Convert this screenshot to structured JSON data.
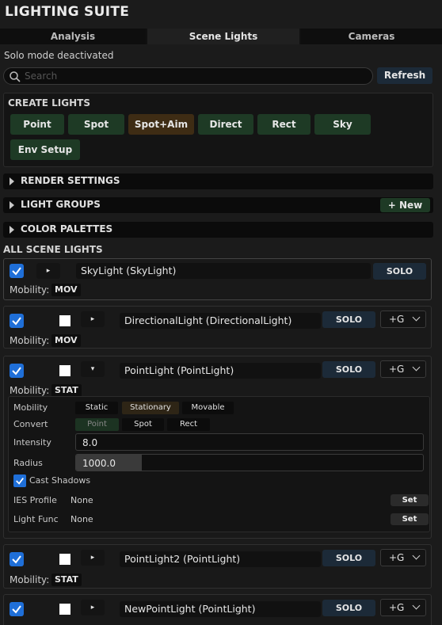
{
  "app": {
    "title": "LIGHTING SUITE"
  },
  "tabs": [
    {
      "label": "Analysis",
      "active": false
    },
    {
      "label": "Scene Lights",
      "active": true
    },
    {
      "label": "Cameras",
      "active": false
    }
  ],
  "status": "Solo mode deactivated",
  "search": {
    "placeholder": "Search",
    "value": ""
  },
  "refresh_label": "Refresh",
  "create": {
    "title": "CREATE LIGHTS",
    "buttons": [
      "Point",
      "Spot",
      "Spot+Aim",
      "Direct",
      "Rect",
      "Sky",
      "Env Setup"
    ]
  },
  "sections": {
    "render": "RENDER SETTINGS",
    "groups": "LIGHT GROUPS",
    "new_label": "+ New",
    "palettes": "COLOR PALETTES"
  },
  "all_lights_title": "ALL SCENE LIGHTS",
  "common": {
    "mobility_label": "Mobility:",
    "solo_label": "SOLO",
    "group_label": "+G"
  },
  "lights": [
    {
      "name": "SkyLight (SkyLight)",
      "mobility": "MOV",
      "checked": true,
      "arrow": "▸"
    },
    {
      "name": "DirectionalLight (DirectionalLight)",
      "mobility": "MOV",
      "checked": true,
      "arrow": "▸"
    },
    {
      "name": "PointLight (PointLight)",
      "mobility": "STAT",
      "checked": true,
      "arrow": "▾"
    },
    {
      "name": "PointLight2 (PointLight)",
      "mobility": "STAT",
      "checked": true,
      "arrow": "▸"
    },
    {
      "name": "NewPointLight (PointLight)",
      "mobility": "",
      "checked": true,
      "arrow": "▸"
    }
  ],
  "details": {
    "mobility_label": "Mobility",
    "mobility_options": [
      "Static",
      "Stationary",
      "Movable"
    ],
    "mobility_selected": "Stationary",
    "convert_label": "Convert",
    "convert_options": [
      "Point",
      "Spot",
      "Rect"
    ],
    "convert_current": "Point",
    "intensity_label": "Intensity",
    "intensity_value": "8.0",
    "radius_label": "Radius",
    "radius_value": "1000.0",
    "radius_fraction": 0.19,
    "cast_shadows_label": "Cast Shadows",
    "cast_shadows": true,
    "ies_label": "IES Profile",
    "ies_value": "None",
    "func_label": "Light Func",
    "func_value": "None",
    "set_label": "Set"
  },
  "colors": {
    "accent_blue": "#1f6fd8",
    "create_green": "#1e3a25",
    "create_amber": "#3e2c14",
    "solo_bg": "#1c2a38"
  }
}
